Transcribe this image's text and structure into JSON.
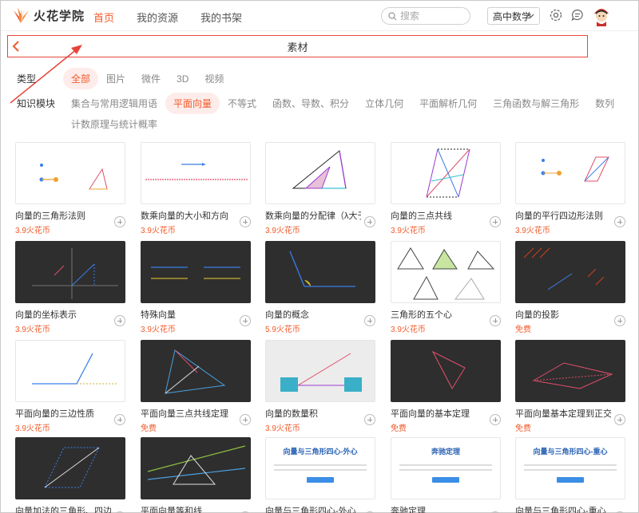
{
  "header": {
    "brand": "火花学院",
    "nav": [
      "首页",
      "我的资源",
      "我的书架"
    ],
    "search_placeholder": "搜索",
    "grade": "高中数学"
  },
  "titlebar": {
    "title": "素材"
  },
  "filters": {
    "type_label": "类型",
    "types": [
      "全部",
      "图片",
      "微件",
      "3D",
      "视频"
    ],
    "module_label": "知识模块",
    "modules": [
      "集合与常用逻辑用语",
      "平面向量",
      "不等式",
      "函数、导数、积分",
      "立体几何",
      "平面解析几何",
      "三角函数与解三角形",
      "数列"
    ],
    "modules_row2": [
      "计数原理与统计概率"
    ]
  },
  "cards": [
    {
      "name": "向量的三角形法则",
      "price": "3.9火花币"
    },
    {
      "name": "数乘向量的大小和方向",
      "price": "3.9火花币"
    },
    {
      "name": "数乘向量的分配律（λ大于...",
      "price": "3.9火花币"
    },
    {
      "name": "向量的三点共线",
      "price": "3.9火花币"
    },
    {
      "name": "向量的平行四边形法则",
      "price": "3.9火花币"
    },
    {
      "name": "向量的坐标表示",
      "price": "3.9火花币"
    },
    {
      "name": "特殊向量",
      "price": "3.9火花币"
    },
    {
      "name": "向量的概念",
      "price": "5.9火花币"
    },
    {
      "name": "三角形的五个心",
      "price": "3.9火花币"
    },
    {
      "name": "向量的投影",
      "price": "免费"
    },
    {
      "name": "平面向量的三边性质",
      "price": "3.9火花币"
    },
    {
      "name": "平面向量三点共线定理",
      "price": "免费"
    },
    {
      "name": "向量的数量积",
      "price": "3.9火花币"
    },
    {
      "name": "平面向量的基本定理",
      "price": "免费"
    },
    {
      "name": "平面向量基本定理到正交分...",
      "price": "免费"
    },
    {
      "name": "向量加法的三角形、四边形...",
      "price": ""
    },
    {
      "name": "平面向量等和线",
      "price": ""
    },
    {
      "name": "向量与三角形四心-外心",
      "price": ""
    },
    {
      "name": "奔驰定理",
      "price": ""
    },
    {
      "name": "向量与三角形四心-重心",
      "price": ""
    }
  ],
  "doc_thumbs": {
    "c17": "向量与三角形四心-外心",
    "c18": "奔驰定理",
    "c19": "向量与三角形四心-重心"
  },
  "colors": {
    "accent": "#f25a2a",
    "highlight_border": "#e5443a"
  }
}
